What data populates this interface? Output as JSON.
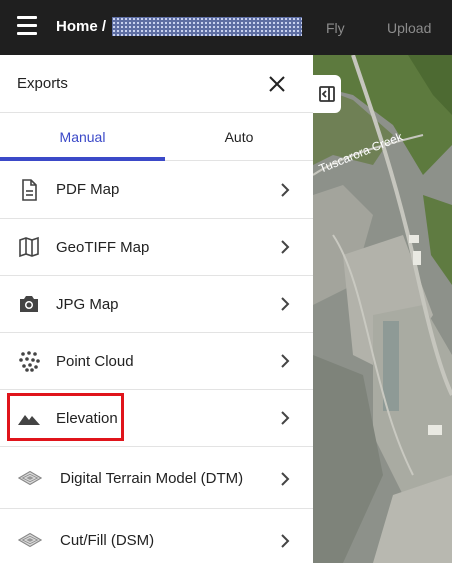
{
  "topbar": {
    "home": "Home /",
    "nav": [
      "Fly",
      "Upload"
    ]
  },
  "panel": {
    "title": "Exports",
    "tabs": [
      {
        "label": "Manual",
        "active": true
      },
      {
        "label": "Auto",
        "active": false
      }
    ],
    "items": [
      {
        "label": "PDF Map",
        "icon": "document-icon"
      },
      {
        "label": "GeoTIFF Map",
        "icon": "map-icon"
      },
      {
        "label": "JPG Map",
        "icon": "camera-icon"
      },
      {
        "label": "Point Cloud",
        "icon": "dots-icon"
      },
      {
        "label": "Elevation",
        "icon": "mountain-icon"
      },
      {
        "label": "Digital Terrain Model (DTM)",
        "icon": "terrain-icon"
      },
      {
        "label": "Cut/Fill (DSM)",
        "icon": "terrain-icon"
      }
    ]
  },
  "map": {
    "label": "Tuscarora Creek"
  },
  "colors": {
    "accent": "#3b49c8",
    "highlight": "#e0141b",
    "topbar": "#1f1f1f"
  }
}
